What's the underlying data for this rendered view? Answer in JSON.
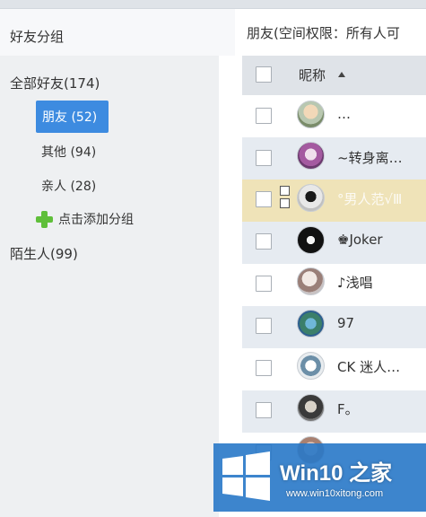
{
  "left_panel": {
    "title": "好友分组",
    "all_friends": "全部好友(174)",
    "groups": [
      {
        "label": "朋友 (52)",
        "selected": true
      },
      {
        "label": "其他 (94)",
        "selected": false
      },
      {
        "label": "亲人 (28)",
        "selected": false
      }
    ],
    "add_group": "点击添加分组",
    "strangers": "陌生人(99)"
  },
  "right_panel": {
    "title": "朋友(空间权限：所有人可",
    "column_nickname": "昵称",
    "friends": [
      {
        "nickname": "…"
      },
      {
        "nickname": "~转身离…"
      },
      {
        "nickname": "°男人范√Ⅲ"
      },
      {
        "nickname": "♚Joker"
      },
      {
        "nickname": "♪浅唱"
      },
      {
        "nickname": "97"
      },
      {
        "nickname": "CK 迷人…"
      },
      {
        "nickname": "F。"
      }
    ]
  },
  "watermark": {
    "brand": "Win10 之家",
    "url": "www.win10xitong.com"
  },
  "colors": {
    "selected_group": "#3d8be0",
    "highlight_row": "#efe3b8",
    "alt_row": "#e6ebf1",
    "add_icon": "#5fbf3a"
  }
}
